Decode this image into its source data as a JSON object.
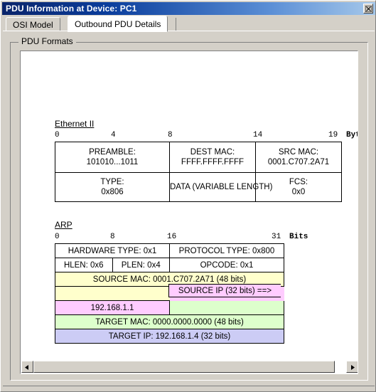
{
  "window": {
    "title": "PDU Information at Device: PC1",
    "close_icon": "close-icon",
    "titlebar_color": "#0a246a"
  },
  "tabs": [
    {
      "label": "OSI Model",
      "active": false
    },
    {
      "label": "Outbound PDU Details",
      "active": true
    }
  ],
  "groupbox": {
    "legend": "PDU Formats"
  },
  "ethernet": {
    "label": "Ethernet II",
    "ruler": {
      "unit": "Bytes",
      "ticks": [
        "0",
        "4",
        "8",
        "14",
        "19"
      ]
    },
    "row1": [
      {
        "line1": "PREAMBLE:",
        "line2": "101010...1011"
      },
      {
        "line1": "DEST MAC:",
        "line2": "FFFF.FFFF.FFFF"
      },
      {
        "line1": "SRC MAC:",
        "line2": "0001.C707.2A71"
      }
    ],
    "row2": [
      {
        "line1": "TYPE:",
        "line2": "0x806"
      },
      {
        "line1": "DATA (VARIABLE LENGTH)",
        "line2": ""
      },
      {
        "line1": "FCS:",
        "line2": "0x0"
      }
    ]
  },
  "arp": {
    "label": "ARP",
    "ruler": {
      "unit": "Bits",
      "ticks": [
        "0",
        "8",
        "16",
        "31"
      ]
    },
    "hardware_type": "HARDWARE TYPE: 0x1",
    "protocol_type": "PROTOCOL TYPE: 0x800",
    "hlen": "HLEN: 0x6",
    "plen": "PLEN: 0x4",
    "opcode": "OPCODE: 0x1",
    "source_mac": "SOURCE MAC: 0001.C707.2A71 (48 bits)",
    "source_ip_label": "SOURCE IP (32 bits) ==>",
    "source_ip_value": "192.168.1.1",
    "target_mac": "TARGET MAC: 0000.0000.0000 (48 bits)",
    "target_ip": "TARGET IP: 192.168.1.4 (32 bits)",
    "colors": {
      "source_mac": "#ffffcc",
      "source_ip": "#ffccff",
      "target_mac": "#ddffcc",
      "target_ip": "#ccccf5"
    }
  },
  "scrollbar": {
    "left_arrow_icon": "arrow-left-icon",
    "right_arrow_icon": "arrow-right-icon"
  }
}
